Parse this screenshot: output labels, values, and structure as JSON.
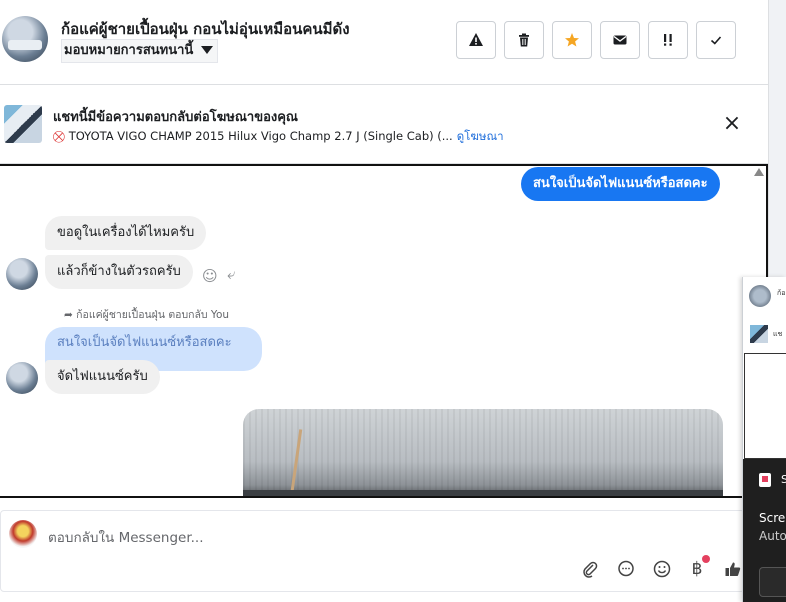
{
  "header": {
    "contact_name": "ก้อแค่ผู้ชายเปื้อนฝุ่น กอนไม่อุ่นเหมือนคนมีดัง",
    "assign_label": "มอบหมายการสนทนานี้",
    "actions": [
      {
        "name": "report",
        "icon": "warning-icon"
      },
      {
        "name": "delete",
        "icon": "trash-icon"
      },
      {
        "name": "star",
        "icon": "star-icon",
        "color": "#f5a623"
      },
      {
        "name": "mark-unread",
        "icon": "envelope-icon"
      },
      {
        "name": "spam",
        "icon": "double-exclamation-icon"
      },
      {
        "name": "done",
        "icon": "checkmark-icon"
      }
    ]
  },
  "ad_banner": {
    "title": "แชทนี้มีข้อความตอบกลับต่อโฆษณาของคุณ",
    "subtitle": "TOYOTA VIGO CHAMP 2015 Hilux Vigo Champ 2.7 J (Single Cab) (...",
    "link": "ดูโฆษณา",
    "close": "×"
  },
  "messages": {
    "out_1": "สนใจเป็นจัดไฟแนนซ์หรือสดคะ",
    "in_1": "ขอดูในเครื่องได้ไหมครับ",
    "in_2": "แล้วก็ข้างในตัวรถครับ",
    "reply_note": "ก้อแค่ผู้ชายเปื้อนฝุ่น ตอบกลับ You",
    "quoted": "สนใจเป็นจัดไฟแนนซ์หรือสดคะ",
    "in_3": "จัดไฟแนนซ์ครับ"
  },
  "composer": {
    "placeholder": "ตอบกลับใน Messenger...",
    "icons": [
      "paperclip-icon",
      "speech-bubble-icon",
      "emoji-icon",
      "baht-icon",
      "thumbs-up-icon"
    ],
    "baht_symbol": "฿"
  },
  "side_panel": {
    "snippet_1": "ก้อ",
    "snippet_2": "แช",
    "dark_title": "S",
    "dark_line_1": "Scre",
    "dark_line_2": "Auto"
  },
  "colors": {
    "accent": "#1877f2",
    "quoted_bg": "#cfe2fd",
    "incoming_bg": "#f0f0f0",
    "link": "#216fdb"
  }
}
